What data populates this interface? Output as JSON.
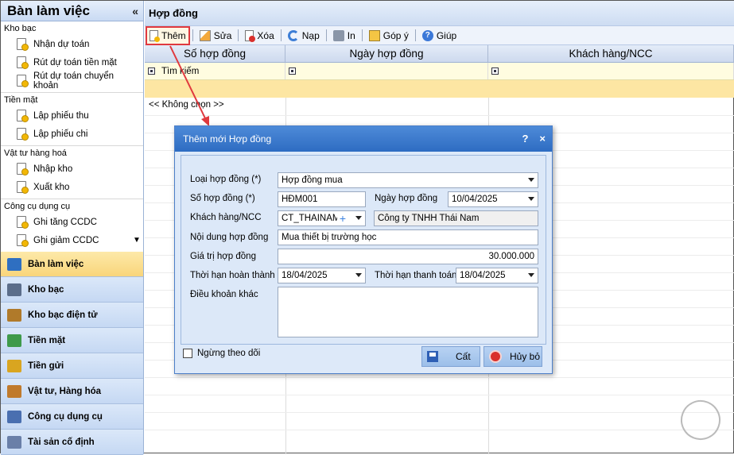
{
  "left_panel": {
    "title": "Bàn làm việc",
    "collapse_icon": "«",
    "groups": [
      {
        "label": "Kho bạc",
        "items": [
          "Nhận dự toán",
          "Rút dự toán tiền mặt",
          "Rút dự toán chuyển khoản"
        ]
      },
      {
        "label": "Tiền mặt",
        "items": [
          "Lập phiếu thu",
          "Lập phiếu chi"
        ]
      },
      {
        "label": "Vật tư hàng hoá",
        "items": [
          "Nhập kho",
          "Xuất kho"
        ]
      },
      {
        "label": "Công cụ dụng cụ",
        "items": [
          "Ghi tăng CCDC",
          "Ghi giảm CCDC"
        ]
      }
    ],
    "modules": [
      {
        "label": "Bàn làm việc",
        "icon": "desk-icon",
        "color": "#2f6fc1"
      },
      {
        "label": "Kho bạc",
        "icon": "treasury-icon",
        "color": "#5b6d8a"
      },
      {
        "label": "Kho bạc điện tử",
        "icon": "e-treasury-icon",
        "color": "#b07a2a"
      },
      {
        "label": "Tiền mặt",
        "icon": "cash-icon",
        "color": "#3f9a4a"
      },
      {
        "label": "Tiền gửi",
        "icon": "deposit-icon",
        "color": "#d9a520"
      },
      {
        "label": "Vật tư, Hàng hóa",
        "icon": "goods-icon",
        "color": "#c07a2c"
      },
      {
        "label": "Công cụ dụng cụ",
        "icon": "tools-icon",
        "color": "#4a6fb0"
      },
      {
        "label": "Tài sản cố định",
        "icon": "assets-icon",
        "color": "#6a7fa8"
      }
    ]
  },
  "main": {
    "title": "Hợp đồng",
    "toolbar": {
      "new": "Thêm",
      "edit": "Sửa",
      "delete": "Xóa",
      "load": "Nạp",
      "print": "In",
      "feedback": "Góp ý",
      "help": "Giúp"
    },
    "columns": [
      "Số hợp đồng",
      "Ngày hợp đồng",
      "Khách hàng/NCC"
    ],
    "filter_text": "Tìm kiếm",
    "none_option": "<< Không chọn >>"
  },
  "dialog": {
    "title": "Thêm mới Hợp đồng",
    "help_glyph": "?",
    "close_glyph": "×",
    "fields": {
      "contract_type_label": "Loại hợp đồng (*)",
      "contract_type_value": "Hợp đồng mua",
      "contract_no_label": "Số hợp đồng (*)",
      "contract_no_value": "HĐM001",
      "contract_date_label": "Ngày hợp đồng",
      "contract_date_value": "10/04/2025",
      "customer_label": "Khách hàng/NCC",
      "customer_code": "CT_THAINAM",
      "customer_name": "Công ty TNHH Thái Nam",
      "content_label": "Nội dung hợp đồng",
      "content_value": "Mua thiết bị trường học",
      "value_label": "Giá trị hợp đồng",
      "value_value": "30.000.000",
      "complete_label": "Thời hạn hoàn thành",
      "complete_value": "18/04/2025",
      "payment_label": "Thời hạn thanh toán",
      "payment_value": "18/04/2025",
      "terms_label": "Điều khoản khác"
    },
    "stop_tracking": "Ngừng theo dõi",
    "save": "Cất",
    "cancel": "Hủy bỏ"
  }
}
